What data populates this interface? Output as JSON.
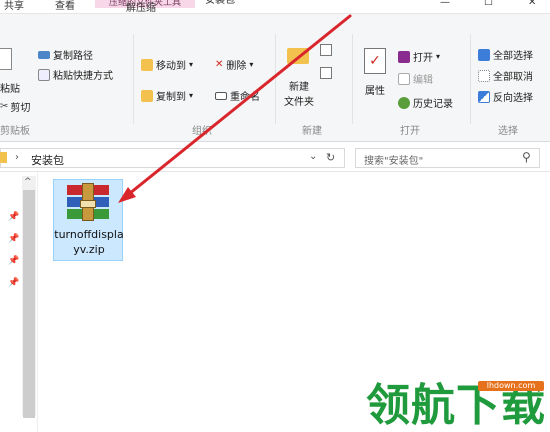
{
  "tabs": {
    "share": "共享",
    "view": "查看",
    "context_title": "压缩的文件夹工具",
    "extract": "解压缩",
    "window_title": "安装包"
  },
  "ribbon": {
    "clipboard": {
      "paste_fragment": "粘贴",
      "cut": "剪切",
      "copy_path": "复制路径",
      "paste_shortcut": "粘贴快捷方式",
      "group": "剪贴板"
    },
    "organize": {
      "move_to": "移动到",
      "copy_to": "复制到",
      "delete": "删除",
      "rename": "重命名",
      "group": "组织"
    },
    "new": {
      "new_folder": "新建\n文件夹",
      "group": "新建"
    },
    "open": {
      "properties": "属性",
      "open": "打开",
      "edit": "编辑",
      "history": "历史记录",
      "group": "打开"
    },
    "select": {
      "select_all": "全部选择",
      "select_none": "全部取消",
      "invert": "反向选择",
      "group": "选择"
    }
  },
  "address": {
    "path": "安装包",
    "search_placeholder": "搜索\"安装包\""
  },
  "file": {
    "name": "turnoffdisplayv.zip"
  },
  "watermark": {
    "text": "领航下载",
    "url": "lhdown.com"
  },
  "colors": {
    "arrow": "#d9262c",
    "selection": "#cce8ff",
    "context_tab": "#f7d7e8",
    "watermark": "#1f9a3c"
  }
}
